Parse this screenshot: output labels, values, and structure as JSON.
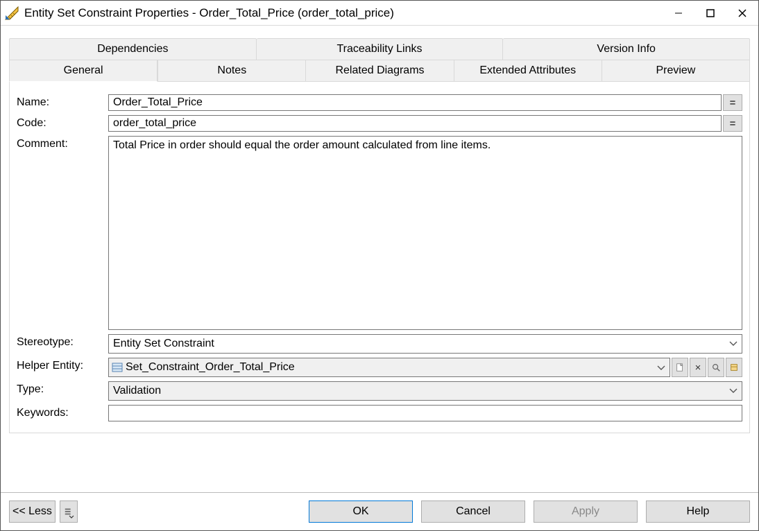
{
  "window": {
    "title": "Entity Set Constraint Properties - Order_Total_Price (order_total_price)"
  },
  "tabs": {
    "top": [
      "Dependencies",
      "Traceability Links",
      "Version Info"
    ],
    "bottom": [
      "General",
      "Notes",
      "Related Diagrams",
      "Extended Attributes",
      "Preview"
    ],
    "active": "General"
  },
  "form": {
    "labels": {
      "name": "Name:",
      "code": "Code:",
      "comment": "Comment:",
      "stereotype": "Stereotype:",
      "helper_entity": "Helper Entity:",
      "type": "Type:",
      "keywords": "Keywords:"
    },
    "name_value": "Order_Total_Price",
    "code_value": "order_total_price",
    "comment_value": "Total Price in order should equal the order amount calculated from line items.",
    "stereotype_value": "Entity Set Constraint",
    "helper_entity_value": "Set_Constraint_Order_Total_Price",
    "type_value": "Validation",
    "keywords_value": ""
  },
  "buttons": {
    "equal": "=",
    "less": "<< Less",
    "ok": "OK",
    "cancel": "Cancel",
    "apply": "Apply",
    "help": "Help",
    "helper_clear": "×"
  },
  "icons": {
    "app": "ruler-icon",
    "entity": "entity-icon",
    "new": "new-icon",
    "clear": "clear-icon",
    "find": "find-icon",
    "props": "props-icon"
  }
}
